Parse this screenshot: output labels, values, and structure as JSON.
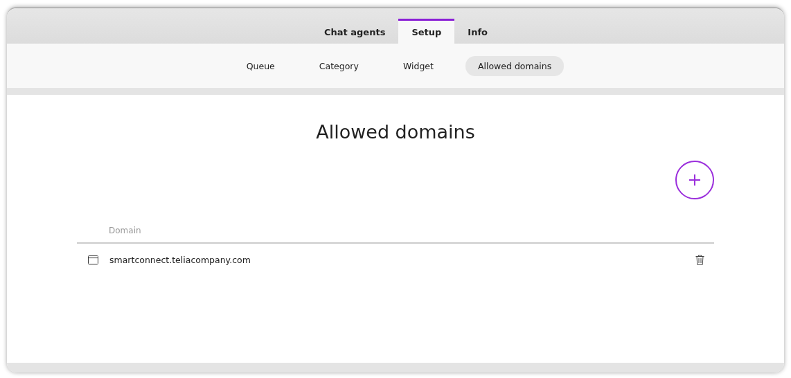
{
  "tabs": [
    {
      "label": "Chat agents",
      "selected": false
    },
    {
      "label": "Setup",
      "selected": true
    },
    {
      "label": "Info",
      "selected": false
    }
  ],
  "subtabs": [
    {
      "label": "Queue",
      "selected": false
    },
    {
      "label": "Category",
      "selected": false
    },
    {
      "label": "Widget",
      "selected": false
    },
    {
      "label": "Allowed domains",
      "selected": true
    }
  ],
  "page_title": "Allowed domains",
  "table": {
    "columns": [
      "Domain"
    ],
    "rows": [
      {
        "domain": "smartconnect.teliacompany.com"
      }
    ]
  }
}
